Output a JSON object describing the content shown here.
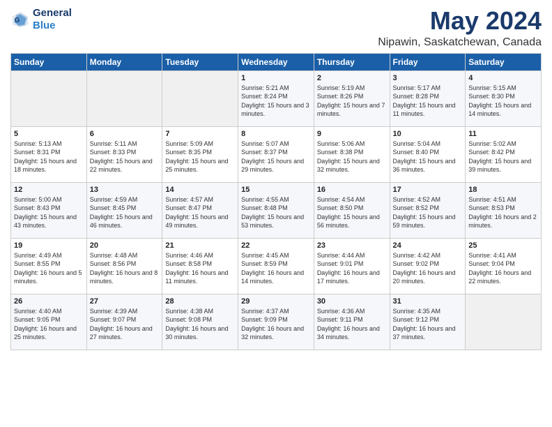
{
  "header": {
    "logo_line1": "General",
    "logo_line2": "Blue",
    "month": "May 2024",
    "location": "Nipawin, Saskatchewan, Canada"
  },
  "weekdays": [
    "Sunday",
    "Monday",
    "Tuesday",
    "Wednesday",
    "Thursday",
    "Friday",
    "Saturday"
  ],
  "weeks": [
    [
      {
        "day": "",
        "info": ""
      },
      {
        "day": "",
        "info": ""
      },
      {
        "day": "",
        "info": ""
      },
      {
        "day": "1",
        "info": "Sunrise: 5:21 AM\nSunset: 8:24 PM\nDaylight: 15 hours and 3 minutes."
      },
      {
        "day": "2",
        "info": "Sunrise: 5:19 AM\nSunset: 8:26 PM\nDaylight: 15 hours and 7 minutes."
      },
      {
        "day": "3",
        "info": "Sunrise: 5:17 AM\nSunset: 8:28 PM\nDaylight: 15 hours and 11 minutes."
      },
      {
        "day": "4",
        "info": "Sunrise: 5:15 AM\nSunset: 8:30 PM\nDaylight: 15 hours and 14 minutes."
      }
    ],
    [
      {
        "day": "5",
        "info": "Sunrise: 5:13 AM\nSunset: 8:31 PM\nDaylight: 15 hours and 18 minutes."
      },
      {
        "day": "6",
        "info": "Sunrise: 5:11 AM\nSunset: 8:33 PM\nDaylight: 15 hours and 22 minutes."
      },
      {
        "day": "7",
        "info": "Sunrise: 5:09 AM\nSunset: 8:35 PM\nDaylight: 15 hours and 25 minutes."
      },
      {
        "day": "8",
        "info": "Sunrise: 5:07 AM\nSunset: 8:37 PM\nDaylight: 15 hours and 29 minutes."
      },
      {
        "day": "9",
        "info": "Sunrise: 5:06 AM\nSunset: 8:38 PM\nDaylight: 15 hours and 32 minutes."
      },
      {
        "day": "10",
        "info": "Sunrise: 5:04 AM\nSunset: 8:40 PM\nDaylight: 15 hours and 36 minutes."
      },
      {
        "day": "11",
        "info": "Sunrise: 5:02 AM\nSunset: 8:42 PM\nDaylight: 15 hours and 39 minutes."
      }
    ],
    [
      {
        "day": "12",
        "info": "Sunrise: 5:00 AM\nSunset: 8:43 PM\nDaylight: 15 hours and 43 minutes."
      },
      {
        "day": "13",
        "info": "Sunrise: 4:59 AM\nSunset: 8:45 PM\nDaylight: 15 hours and 46 minutes."
      },
      {
        "day": "14",
        "info": "Sunrise: 4:57 AM\nSunset: 8:47 PM\nDaylight: 15 hours and 49 minutes."
      },
      {
        "day": "15",
        "info": "Sunrise: 4:55 AM\nSunset: 8:48 PM\nDaylight: 15 hours and 53 minutes."
      },
      {
        "day": "16",
        "info": "Sunrise: 4:54 AM\nSunset: 8:50 PM\nDaylight: 15 hours and 56 minutes."
      },
      {
        "day": "17",
        "info": "Sunrise: 4:52 AM\nSunset: 8:52 PM\nDaylight: 15 hours and 59 minutes."
      },
      {
        "day": "18",
        "info": "Sunrise: 4:51 AM\nSunset: 8:53 PM\nDaylight: 16 hours and 2 minutes."
      }
    ],
    [
      {
        "day": "19",
        "info": "Sunrise: 4:49 AM\nSunset: 8:55 PM\nDaylight: 16 hours and 5 minutes."
      },
      {
        "day": "20",
        "info": "Sunrise: 4:48 AM\nSunset: 8:56 PM\nDaylight: 16 hours and 8 minutes."
      },
      {
        "day": "21",
        "info": "Sunrise: 4:46 AM\nSunset: 8:58 PM\nDaylight: 16 hours and 11 minutes."
      },
      {
        "day": "22",
        "info": "Sunrise: 4:45 AM\nSunset: 8:59 PM\nDaylight: 16 hours and 14 minutes."
      },
      {
        "day": "23",
        "info": "Sunrise: 4:44 AM\nSunset: 9:01 PM\nDaylight: 16 hours and 17 minutes."
      },
      {
        "day": "24",
        "info": "Sunrise: 4:42 AM\nSunset: 9:02 PM\nDaylight: 16 hours and 20 minutes."
      },
      {
        "day": "25",
        "info": "Sunrise: 4:41 AM\nSunset: 9:04 PM\nDaylight: 16 hours and 22 minutes."
      }
    ],
    [
      {
        "day": "26",
        "info": "Sunrise: 4:40 AM\nSunset: 9:05 PM\nDaylight: 16 hours and 25 minutes."
      },
      {
        "day": "27",
        "info": "Sunrise: 4:39 AM\nSunset: 9:07 PM\nDaylight: 16 hours and 27 minutes."
      },
      {
        "day": "28",
        "info": "Sunrise: 4:38 AM\nSunset: 9:08 PM\nDaylight: 16 hours and 30 minutes."
      },
      {
        "day": "29",
        "info": "Sunrise: 4:37 AM\nSunset: 9:09 PM\nDaylight: 16 hours and 32 minutes."
      },
      {
        "day": "30",
        "info": "Sunrise: 4:36 AM\nSunset: 9:11 PM\nDaylight: 16 hours and 34 minutes."
      },
      {
        "day": "31",
        "info": "Sunrise: 4:35 AM\nSunset: 9:12 PM\nDaylight: 16 hours and 37 minutes."
      },
      {
        "day": "",
        "info": ""
      }
    ]
  ]
}
